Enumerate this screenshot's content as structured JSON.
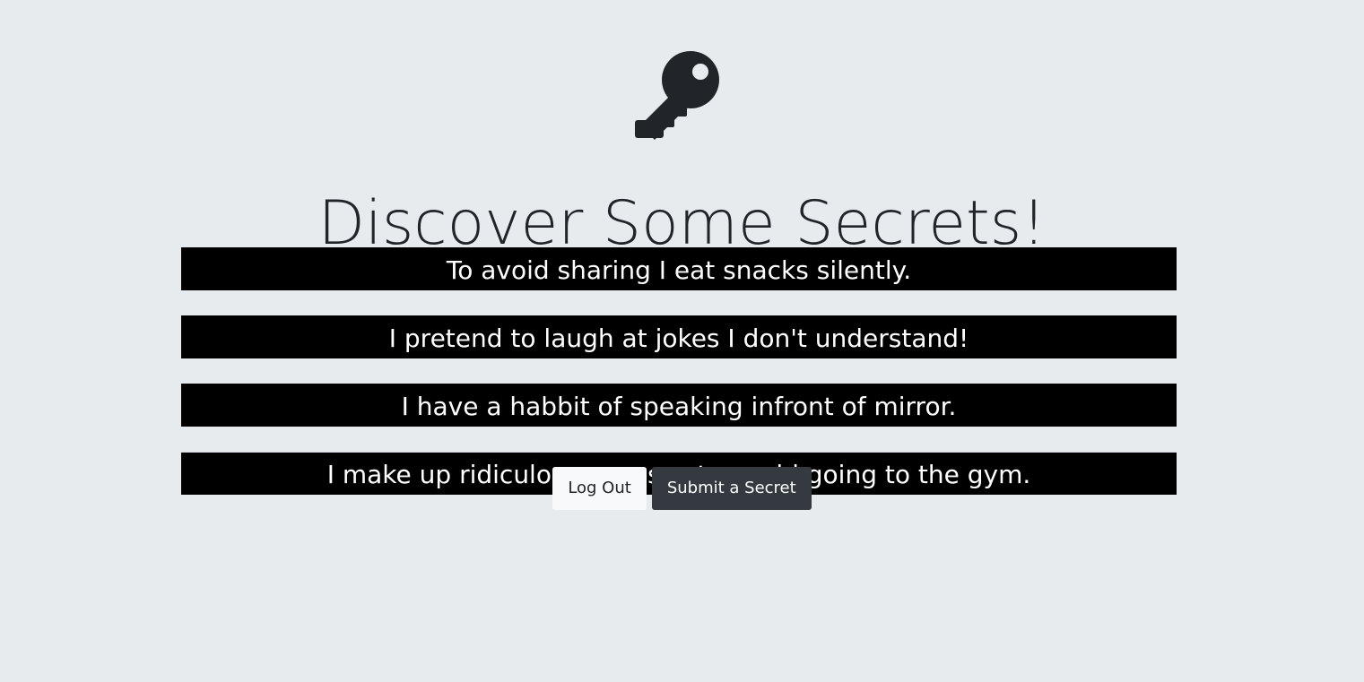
{
  "page": {
    "background": "#e8ebee",
    "title": "Discover Some Secrets!",
    "icon": "key-icon"
  },
  "secrets": [
    {
      "text": "To avoid sharing I eat snacks silently."
    },
    {
      "text": "I pretend to laugh at jokes I don't understand!"
    },
    {
      "text": "I have a habbit of speaking infront of mirror."
    },
    {
      "text": "I make up ridiculous excuses to avoid going to the gym."
    }
  ],
  "actions": {
    "logout_label": "Log Out",
    "submit_label": "Submit a Secret"
  },
  "colors": {
    "secret_background": "#000000",
    "secret_text": "#ffffff",
    "primary_dark_button": "#343a40",
    "light_button": "#f8f9fa",
    "icon_color": "#212529"
  }
}
